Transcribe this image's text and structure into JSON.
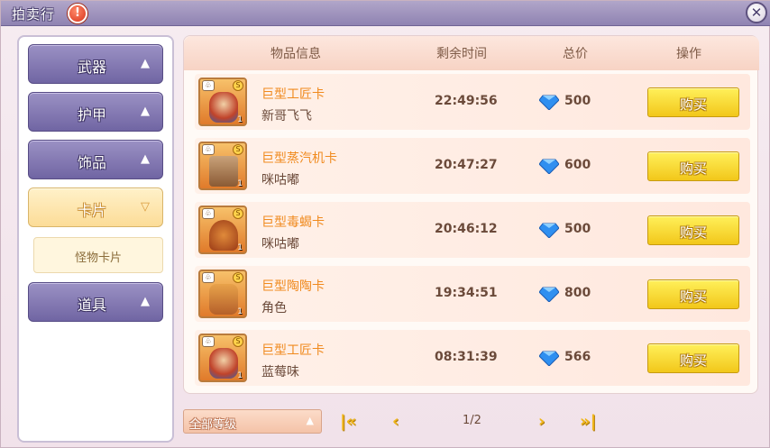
{
  "window": {
    "title": "拍卖行"
  },
  "categories": [
    {
      "label": "武器",
      "arrow": "▲",
      "active": false
    },
    {
      "label": "护甲",
      "arrow": "▲",
      "active": false
    },
    {
      "label": "饰品",
      "arrow": "▲",
      "active": false
    },
    {
      "label": "卡片",
      "arrow": "▽",
      "active": true
    },
    {
      "label": "道具",
      "arrow": "▲",
      "active": false
    }
  ],
  "sub_category": {
    "label": "怪物卡片"
  },
  "table": {
    "headers": {
      "item": "物品信息",
      "time": "剩余时间",
      "price": "总价",
      "action": "操作"
    },
    "rows": [
      {
        "name": "巨型工匠卡",
        "seller": "新哥飞飞",
        "time": "22:49:56",
        "price": "500",
        "buy": "购买",
        "qty": "1"
      },
      {
        "name": "巨型蒸汽机卡",
        "seller": "咪咕嘟",
        "time": "20:47:27",
        "price": "600",
        "buy": "购买",
        "qty": "1"
      },
      {
        "name": "巨型毒蝎卡",
        "seller": "咪咕嘟",
        "time": "20:46:12",
        "price": "500",
        "buy": "购买",
        "qty": "1"
      },
      {
        "name": "巨型陶陶卡",
        "seller": "角色",
        "time": "19:34:51",
        "price": "800",
        "buy": "购买",
        "qty": "1"
      },
      {
        "name": "巨型工匠卡",
        "seller": "蓝莓味",
        "time": "08:31:39",
        "price": "566",
        "buy": "购买",
        "qty": "1"
      }
    ]
  },
  "footer": {
    "level_filter": "全部等级",
    "page": "1/2"
  },
  "icons": {
    "help": "help-icon",
    "close": "close-icon",
    "currency": "blue-gem-icon"
  },
  "colors": {
    "title_bar": "#8f83b2",
    "item_name": "#f08a1e",
    "buy_button": "#f2c71a",
    "category_button": "#7065a3",
    "active_category": "#fcdc97"
  }
}
